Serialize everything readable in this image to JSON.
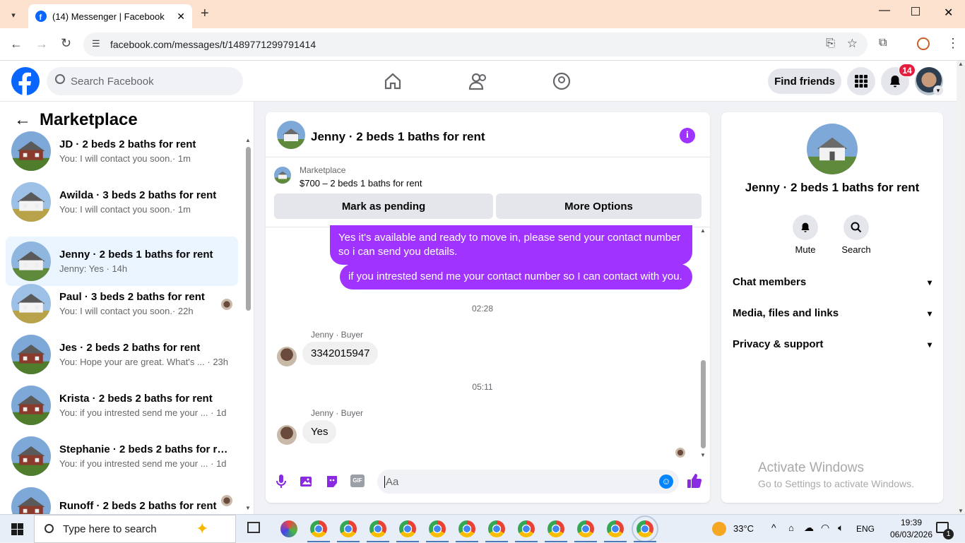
{
  "browser": {
    "tab_title": "(14) Messenger | Facebook",
    "url": "facebook.com/messages/t/1489771299791414"
  },
  "fb": {
    "search_placeholder": "Search Facebook",
    "find_friends": "Find friends",
    "notifications_count": "14"
  },
  "sidebar": {
    "title": "Marketplace",
    "conversations": [
      {
        "title": "JD · 2 beds 2 baths for rent",
        "preview": "You: I will contact you soon.· 1m"
      },
      {
        "title": "Awilda · 3 beds 2 baths for rent",
        "preview": "You: I will contact you soon.· 1m"
      },
      {
        "title": "Jenny · 2 beds 1 baths for rent",
        "preview": "Jenny: Yes · 14h"
      },
      {
        "title": "Paul · 3 beds 2 baths for rent",
        "preview": "You: I will contact you soon.· 22h"
      },
      {
        "title": "Jes · 2 beds 2 baths for rent",
        "preview": "You: Hope your are great. What's ...  · 23h"
      },
      {
        "title": "Krista · 2 beds 2 baths for rent",
        "preview": "You: if you intrested send me your ...  · 1d"
      },
      {
        "title": "Stephanie · 2 beds 2 baths for re...",
        "preview": "You: if you intrested send me your ...  · 1d"
      },
      {
        "title": "Runoff · 2 beds 2 baths for rent",
        "preview": ""
      }
    ]
  },
  "chat": {
    "header_title": "Jenny · 2 beds 1 baths for rent",
    "listing_source": "Marketplace",
    "listing_desc": "$700 – 2 beds 1 baths for rent",
    "mark_pending": "Mark as pending",
    "more_options": "More Options",
    "messages": {
      "out1": "Yes it's available and ready to move in, please send your contact number so i can send you details.",
      "out2": "if you intrested send me your contact number so I can contact with you.",
      "ts1": "02:28",
      "sender1": "Jenny · Buyer",
      "in1": "3342015947",
      "ts2": "05:11",
      "sender2": "Jenny · Buyer",
      "in2": "Yes"
    },
    "composer_placeholder": "Aa"
  },
  "info": {
    "title": "Jenny · 2 beds 1 baths for rent",
    "mute": "Mute",
    "search": "Search",
    "sections": [
      "Chat members",
      "Media, files and links",
      "Privacy & support"
    ],
    "watermark_title": "Activate Windows",
    "watermark_sub": "Go to Settings to activate Windows."
  },
  "taskbar": {
    "search_placeholder": "Type here to search",
    "weather": "33°C",
    "lang": "ENG",
    "time": "19:39",
    "date": "06/03/2026"
  },
  "colors": {
    "accent": "#a033ff",
    "fb_blue": "#0866ff",
    "tabbar": "#fde1cf"
  }
}
